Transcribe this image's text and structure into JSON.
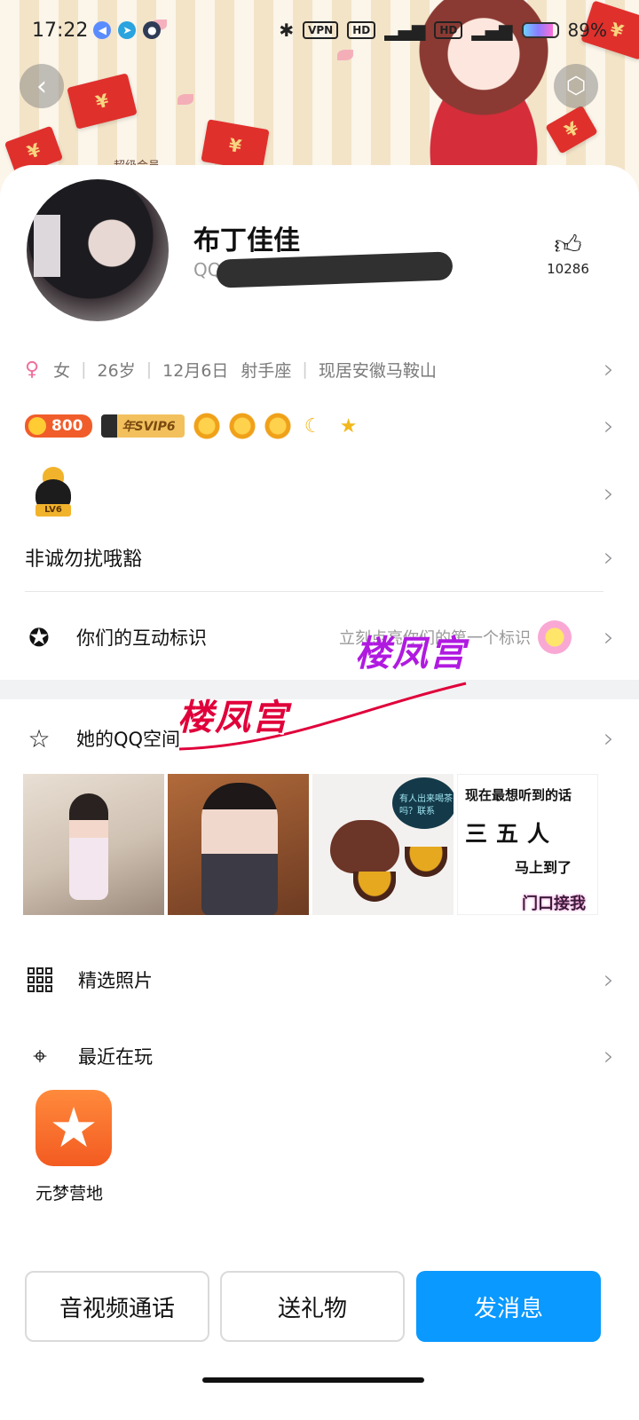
{
  "status_bar": {
    "time": "17:22",
    "vpn": "VPN",
    "battery": "89%",
    "battery_level": 0.89
  },
  "banner": {
    "small_text": "超级会员"
  },
  "profile": {
    "nickname": "布丁佳佳",
    "qq_prefix": "QQ",
    "likes": "10286",
    "gender_symbol": "♀",
    "gender": "女",
    "age": "26岁",
    "birthday": "12月6日",
    "zodiac": "射手座",
    "location": "现居安徽马鞍山"
  },
  "badges": {
    "coin": "800",
    "svip": "年SVIP6",
    "level_icons": [
      "sun-icon",
      "sun-icon",
      "sun-icon",
      "moon-icon",
      "star-icon"
    ],
    "level_badge": "LV6"
  },
  "motto": "非诚勿扰哦豁",
  "interaction": {
    "label": "你们的互动标识",
    "hint": "立刻点亮你们的第一个标识"
  },
  "qzone": {
    "label": "她的QQ空间"
  },
  "photos": {
    "p3_bubble": "有人出来喝茶吗？联系",
    "p4": {
      "line1": "现在最想听到的话",
      "line2": "三五人",
      "line3": "马上到了",
      "line4": "门口接我"
    }
  },
  "sections": {
    "picked_photos": "精选照片",
    "recent_play": "最近在玩"
  },
  "recent_game": {
    "name": "元梦营地"
  },
  "actions": {
    "call": "音视频通话",
    "gift": "送礼物",
    "message": "发消息"
  },
  "watermarks": [
    "楼凤宫",
    "楼凤宫"
  ],
  "colors": {
    "primary": "#0a99ff",
    "female": "#ef6f9c",
    "watermark_red": "#e0003a",
    "watermark_purple": "#b01ae0"
  }
}
